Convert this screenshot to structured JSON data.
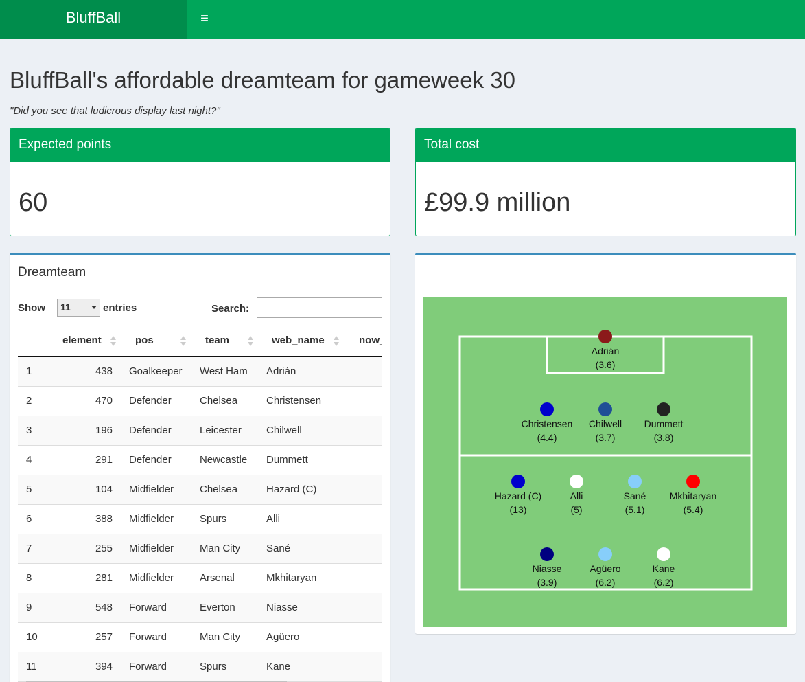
{
  "app": {
    "brand": "BluffBall"
  },
  "page": {
    "title": "BluffBall's affordable dreamteam for gameweek 30",
    "subtitle": "\"Did you see that ludicrous display last night?\""
  },
  "boxes": {
    "points": {
      "label": "Expected points",
      "value": "60"
    },
    "cost": {
      "label": "Total cost",
      "value": "£99.9 million"
    }
  },
  "table": {
    "title": "Dreamteam",
    "show_label": "Show",
    "page_length": "11",
    "entries_label": "entries",
    "search_label": "Search:",
    "search_value": "",
    "columns": [
      "",
      "element",
      "pos",
      "team",
      "web_name",
      "now_"
    ],
    "rows": [
      [
        "1",
        "438",
        "Goalkeeper",
        "West Ham",
        "Adrián"
      ],
      [
        "2",
        "470",
        "Defender",
        "Chelsea",
        "Christensen"
      ],
      [
        "3",
        "196",
        "Defender",
        "Leicester",
        "Chilwell"
      ],
      [
        "4",
        "291",
        "Defender",
        "Newcastle",
        "Dummett"
      ],
      [
        "5",
        "104",
        "Midfielder",
        "Chelsea",
        "Hazard (C)"
      ],
      [
        "6",
        "388",
        "Midfielder",
        "Spurs",
        "Alli"
      ],
      [
        "7",
        "255",
        "Midfielder",
        "Man City",
        "Sané"
      ],
      [
        "8",
        "281",
        "Midfielder",
        "Arsenal",
        "Mkhitaryan"
      ],
      [
        "9",
        "548",
        "Forward",
        "Everton",
        "Niasse"
      ],
      [
        "10",
        "257",
        "Forward",
        "Man City",
        "Agüero"
      ],
      [
        "11",
        "394",
        "Forward",
        "Spurs",
        "Kane"
      ]
    ]
  },
  "pitch": {
    "colors": {
      "grass": "#80cc7a",
      "lines": "#ffffff"
    },
    "players": [
      {
        "name": "Adrián",
        "cost": "(3.6)",
        "color": "#8b1a1a",
        "line": "gk",
        "slot": 0
      },
      {
        "name": "Christensen",
        "cost": "(4.4)",
        "color": "#0000cd",
        "line": "def",
        "slot": 0
      },
      {
        "name": "Chilwell",
        "cost": "(3.7)",
        "color": "#1f4e96",
        "line": "def",
        "slot": 1
      },
      {
        "name": "Dummett",
        "cost": "(3.8)",
        "color": "#222222",
        "line": "def",
        "slot": 2
      },
      {
        "name": "Hazard (C)",
        "cost": "(13)",
        "color": "#0000cd",
        "line": "mid",
        "slot": 0
      },
      {
        "name": "Alli",
        "cost": "(5)",
        "color": "#ffffff",
        "line": "mid",
        "slot": 1
      },
      {
        "name": "Sané",
        "cost": "(5.1)",
        "color": "#87cefa",
        "line": "mid",
        "slot": 2
      },
      {
        "name": "Mkhitaryan",
        "cost": "(5.4)",
        "color": "#ff0000",
        "line": "mid",
        "slot": 3
      },
      {
        "name": "Niasse",
        "cost": "(3.9)",
        "color": "#000080",
        "line": "fwd",
        "slot": 0
      },
      {
        "name": "Agüero",
        "cost": "(6.2)",
        "color": "#87cefa",
        "line": "fwd",
        "slot": 1
      },
      {
        "name": "Kane",
        "cost": "(6.2)",
        "color": "#ffffff",
        "line": "fwd",
        "slot": 2
      }
    ]
  }
}
